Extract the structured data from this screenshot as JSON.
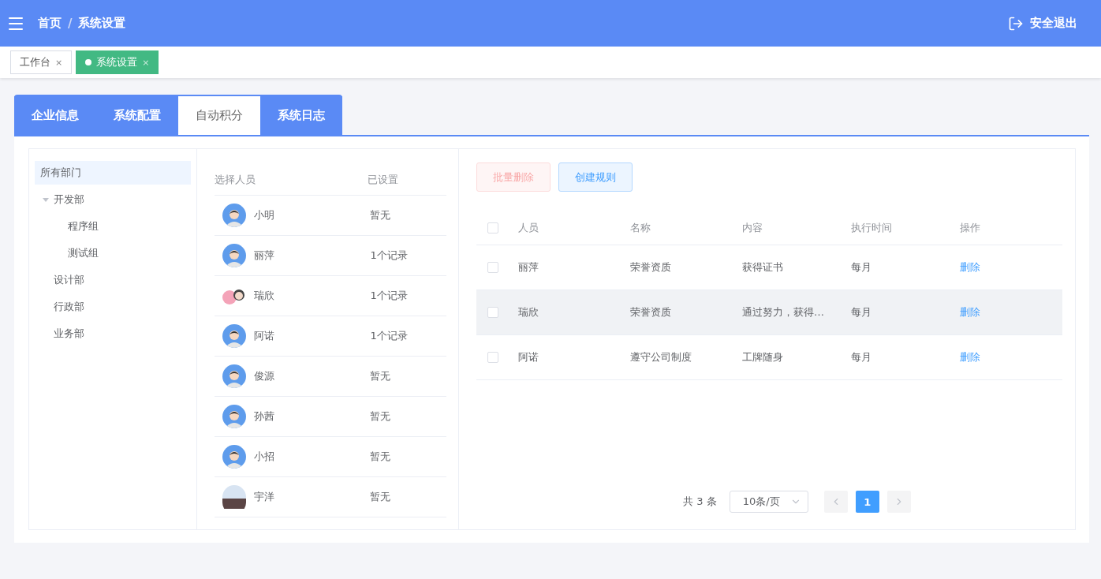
{
  "header": {
    "breadcrumb": [
      {
        "label": "首页"
      },
      {
        "label": "系统设置"
      }
    ],
    "separator": "/",
    "logout": "安全退出"
  },
  "tags": [
    {
      "label": "工作台",
      "selected": false,
      "close": "×"
    },
    {
      "label": "系统设置",
      "selected": true,
      "close": "×"
    }
  ],
  "tabs": [
    {
      "label": "企业信息",
      "selected": false
    },
    {
      "label": "系统配置",
      "selected": false
    },
    {
      "label": "自动积分",
      "selected": true
    },
    {
      "label": "系统日志",
      "selected": false
    }
  ],
  "tree": [
    {
      "label": "所有部门",
      "selected": true,
      "children": [
        {
          "label": "开发部",
          "selected": false,
          "expanded": true,
          "children": [
            {
              "label": "程序组",
              "selected": false
            },
            {
              "label": "测试组",
              "selected": false
            }
          ]
        },
        {
          "label": "设计部",
          "selected": false
        },
        {
          "label": "行政部",
          "selected": false
        },
        {
          "label": "业务部",
          "selected": false
        }
      ]
    }
  ],
  "people": {
    "columns": [
      "选择人员",
      "已设置"
    ],
    "rows": [
      {
        "name": "小明",
        "status": "暂无",
        "kind": "cartoon"
      },
      {
        "name": "丽萍",
        "status": "1个记录",
        "kind": "cartoon"
      },
      {
        "name": "瑞欣",
        "status": "1个记录",
        "kind": "sticker"
      },
      {
        "name": "阿诺",
        "status": "1个记录",
        "kind": "cartoon"
      },
      {
        "name": "俊源",
        "status": "暂无",
        "kind": "cartoon"
      },
      {
        "name": "孙茜",
        "status": "暂无",
        "kind": "cartoon"
      },
      {
        "name": "小招",
        "status": "暂无",
        "kind": "cartoon"
      },
      {
        "name": "宇洋",
        "status": "暂无",
        "kind": "photo"
      }
    ]
  },
  "actions": [
    {
      "label": "批量删除",
      "kind": "danger",
      "disabled": true
    },
    {
      "label": "创建规则",
      "kind": "primary",
      "disabled": false
    }
  ],
  "rules": {
    "header_checked": false,
    "columns": [
      "人员",
      "名称",
      "内容",
      "执行时间",
      "操作"
    ],
    "rows": [
      {
        "checked": false,
        "highlighted": false,
        "cells": [
          "丽萍",
          "荣誉资质",
          "获得证书",
          "每月"
        ],
        "action": "删除"
      },
      {
        "checked": false,
        "highlighted": true,
        "cells": [
          "瑞欣",
          "荣誉资质",
          "通过努力，获得…",
          "每月"
        ],
        "action": "删除"
      },
      {
        "checked": false,
        "highlighted": false,
        "cells": [
          "阿诺",
          "遵守公司制度",
          "工牌随身",
          "每月"
        ],
        "action": "删除"
      }
    ]
  },
  "pagination": {
    "total": "共 3 条",
    "page_size": "10条/页",
    "pages": [
      {
        "label": "1",
        "selected": true
      }
    ],
    "prev_disabled": true,
    "next_disabled": true
  }
}
